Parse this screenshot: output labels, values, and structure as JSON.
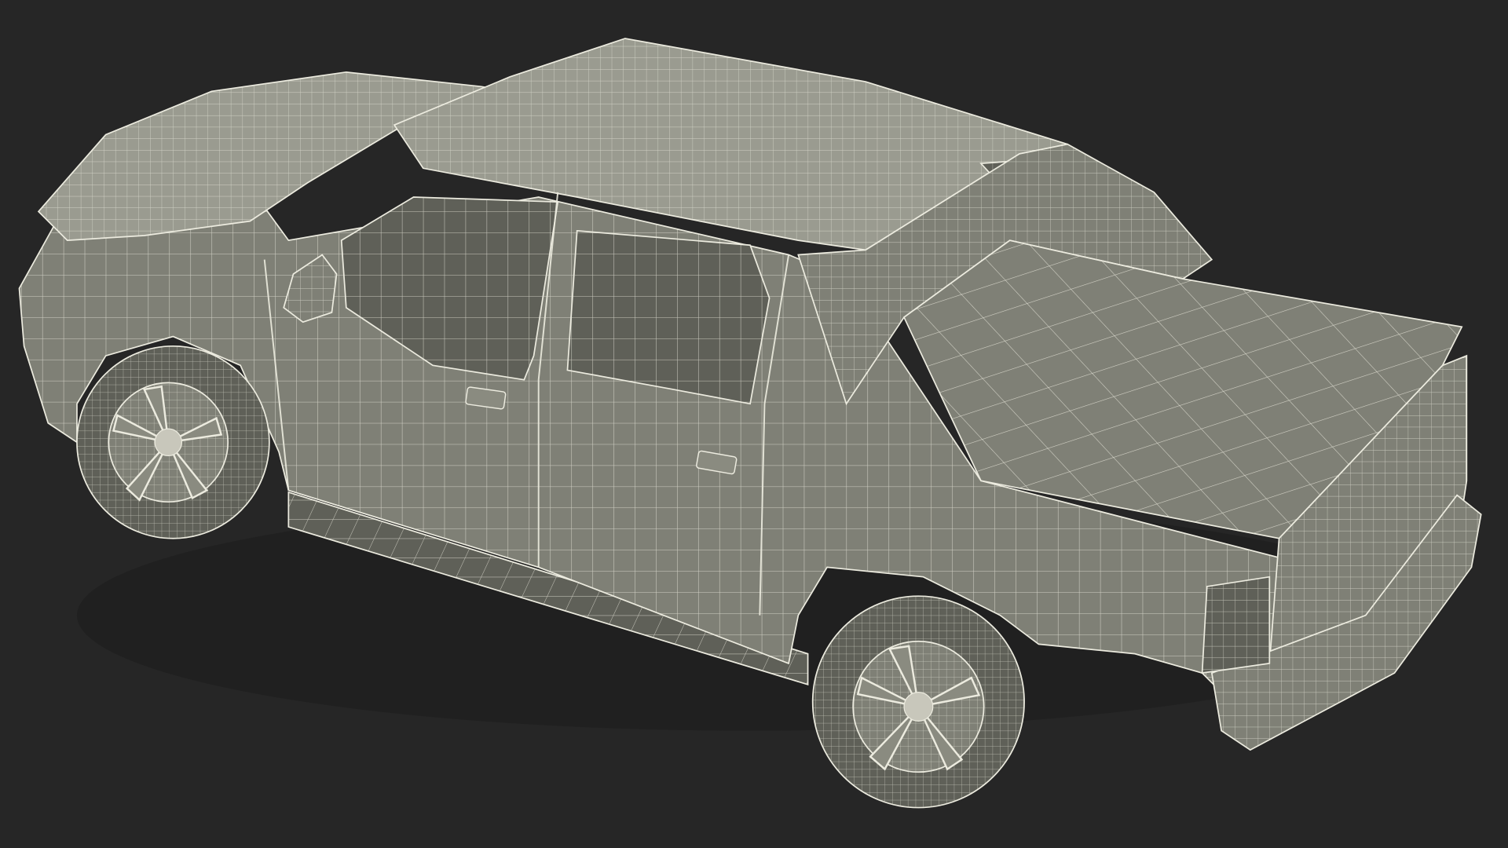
{
  "scene": {
    "background_color": "#262626",
    "model_subject": "pickup-truck",
    "render_style": "wireframe-over-clay",
    "clay_color": "#7f8076",
    "clay_shadow_color": "#5f6058",
    "clay_highlight_color": "#9a9b90",
    "wire_color": "#ecebdf",
    "icons": [
      "wireframe-pickup-truck"
    ]
  }
}
